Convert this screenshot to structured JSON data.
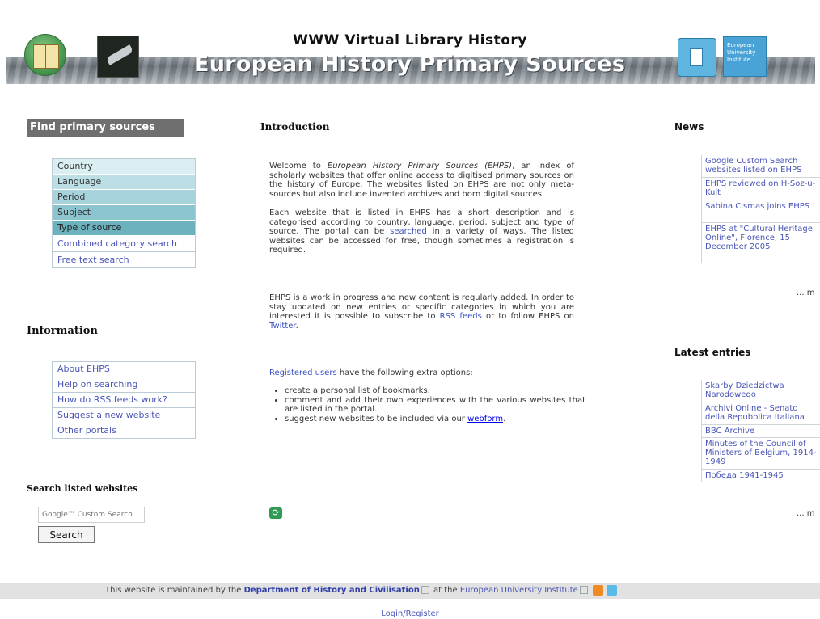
{
  "header": {
    "subtitle": "WWW Virtual Library History",
    "title": "European History Primary Sources",
    "eui_logo_text": "European University Institute"
  },
  "left": {
    "find_heading": "Find primary sources",
    "categories": [
      {
        "label": "Country"
      },
      {
        "label": "Language"
      },
      {
        "label": "Period"
      },
      {
        "label": "Subject"
      },
      {
        "label": "Type of source"
      },
      {
        "label": "Combined category search"
      },
      {
        "label": "Free text search"
      }
    ],
    "info_heading": "Information",
    "info_items": [
      {
        "label": "About EHPS"
      },
      {
        "label": "Help on searching"
      },
      {
        "label": "How do RSS feeds work?"
      },
      {
        "label": "Suggest a new website"
      },
      {
        "label": "Other portals"
      }
    ],
    "search_heading": "Search listed websites",
    "search_placeholder": "Google™ Custom Search",
    "search_button": "Search"
  },
  "center": {
    "heading": "Introduction",
    "p1_a": "Welcome to ",
    "p1_italic": "European History Primary Sources (EHPS)",
    "p1_b": ", an index of scholarly websites that offer online access to digitised primary sources on the history of Europe. The websites listed on EHPS are not only meta-sources but also include invented archives and born digital sources.",
    "p2_a": "Each website that is listed in EHPS has a short description and is categorised according to country, language, period, subject and type of source. The portal can be ",
    "p2_link": "searched",
    "p2_b": " in a variety of ways. The listed websites can be accessed for free, though sometimes a registration is required.",
    "p3_a": "EHPS is a work in progress and new content is regularly added. In order to stay updated on new entries or specific categories in which you are interested it is possible to subscribe to ",
    "p3_link1": "RSS feeds",
    "p3_b": " or to follow EHPS on ",
    "p3_link2": "Twitter",
    "p3_c": ".",
    "registered_link": "Registered users",
    "registered_text": " have the following extra options:",
    "options": [
      "create a personal list of bookmarks.",
      "comment and add their own experiences with the various websites that are listed in the portal.",
      "suggest new websites to be included via our "
    ],
    "webform_link": "webform",
    "webform_end": "."
  },
  "right": {
    "news_heading": "News",
    "news": [
      {
        "label": "Google Custom Search websites listed on EHPS"
      },
      {
        "label": "EHPS reviewed on H-Soz-u-Kult"
      },
      {
        "label": "Sabina Cismas joins EHPS"
      },
      {
        "label": "EHPS at \"Cultural Heritage Online\", Florence, 15 December 2005"
      }
    ],
    "news_more": "... m",
    "latest_heading": "Latest entries",
    "latest": [
      {
        "label": "Skarby Dziedzictwa Narodowego"
      },
      {
        "label": "Archivi Online - Senato della Repubblica Italiana"
      },
      {
        "label": "BBC Archive"
      },
      {
        "label": "Minutes of the Council of Ministers of Belgium, 1914-1949"
      },
      {
        "label": "Победа 1941-1945"
      }
    ],
    "latest_more": "... m"
  },
  "footer": {
    "text_a": "This website is maintained by the ",
    "dept": "Department of History and Civilisation",
    "text_b": " at the ",
    "eui": "European University Institute",
    "login": "Login/Register"
  },
  "colors": {
    "link": "#3a4fc0",
    "menu_heading_bg": "#6f6f6f",
    "footer_bg": "#e2e2e2"
  }
}
